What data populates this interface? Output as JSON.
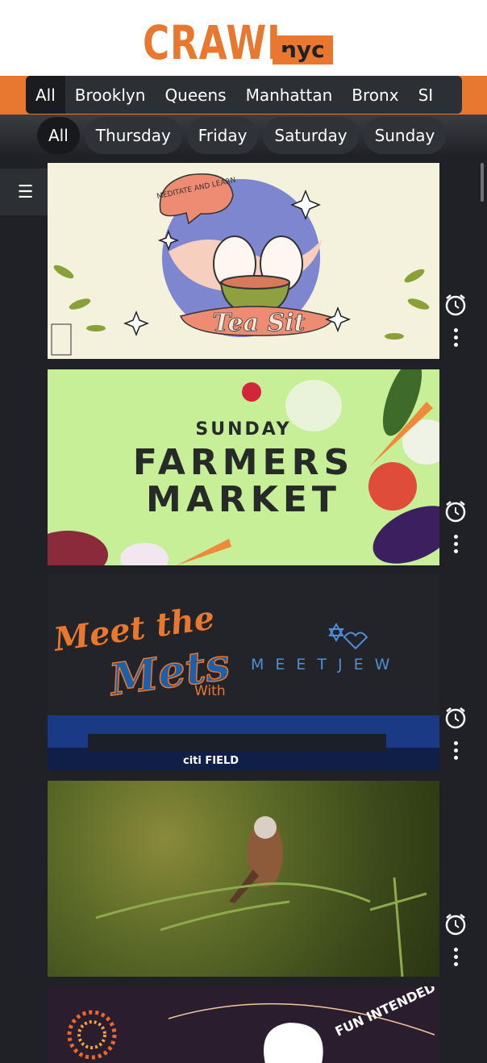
{
  "brand": {
    "name": "CRAWL",
    "suffix": "nyc",
    "primary_color": "#e8782f",
    "nyc_bg": "#e8782f"
  },
  "boroughs": [
    {
      "label": "All",
      "active": true
    },
    {
      "label": "Brooklyn",
      "active": false
    },
    {
      "label": "Queens",
      "active": false
    },
    {
      "label": "Manhattan",
      "active": false
    },
    {
      "label": "Bronx",
      "active": false
    },
    {
      "label": "SI",
      "active": false
    }
  ],
  "days": [
    {
      "label": "All",
      "active": true
    },
    {
      "label": "Thursday",
      "active": false
    },
    {
      "label": "Friday",
      "active": false
    },
    {
      "label": "Saturday",
      "active": false
    },
    {
      "label": "Sunday",
      "active": false
    }
  ],
  "menu": {
    "icon": "hamburger-menu-icon",
    "glyph": "☰"
  },
  "events": [
    {
      "image_text": [
        "MEDITATE AND LEARN",
        "Tea Sit"
      ]
    },
    {
      "image_text": [
        "SUNDAY",
        "FARMERS",
        "MARKET"
      ]
    },
    {
      "image_text": [
        "Meet the",
        "Mets",
        "With",
        "MEETJEW",
        "citi FIELD"
      ]
    },
    {
      "image_text": []
    },
    {
      "image_text": [
        "FUN INTENDED"
      ]
    }
  ],
  "icons": {
    "alarm": "alarm-clock-icon",
    "more": "more-vertical-icon"
  }
}
